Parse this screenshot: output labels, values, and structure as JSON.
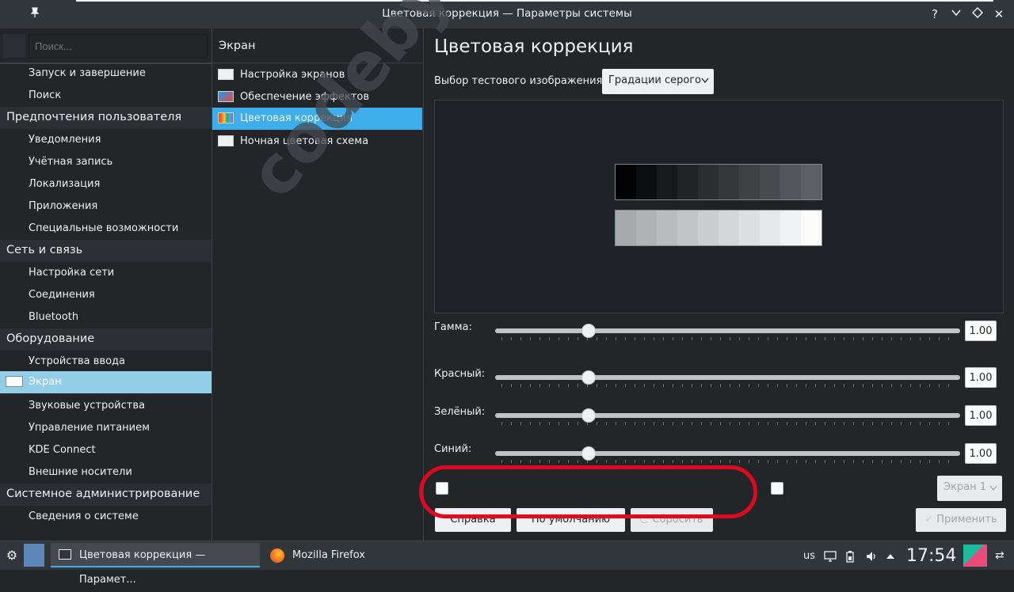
{
  "window": {
    "title": "Цветовая коррекция — Параметры системы",
    "pin_icon": "pin-icon",
    "help_icon": "?",
    "minimize_icon": "chevron-down-icon",
    "maximize_icon": "diamond-icon",
    "close_icon": "✕"
  },
  "sidebar": {
    "search_placeholder": "Поиск...",
    "categories": [
      {
        "label": "Предпочтения пользователя"
      },
      {
        "label": "Сеть и связь"
      },
      {
        "label": "Оборудование"
      },
      {
        "label": "Системное администрирование"
      }
    ],
    "items": [
      {
        "label": "Запуск и завершение"
      },
      {
        "label": "Поиск"
      },
      {
        "label": "Уведомления"
      },
      {
        "label": "Учётная запись"
      },
      {
        "label": "Локализация"
      },
      {
        "label": "Приложения"
      },
      {
        "label": "Специальные возможности"
      },
      {
        "label": "Настройка сети"
      },
      {
        "label": "Соединения"
      },
      {
        "label": "Bluetooth"
      },
      {
        "label": "Устройства ввода"
      },
      {
        "label": "Экран"
      },
      {
        "label": "Звуковые устройства"
      },
      {
        "label": "Управление питанием"
      },
      {
        "label": "KDE Connect"
      },
      {
        "label": "Внешние носители"
      },
      {
        "label": "Сведения о системе"
      }
    ]
  },
  "midpane": {
    "header": "Экран",
    "items": [
      {
        "label": "Настройка экранов"
      },
      {
        "label": "Обеспечение эффектов"
      },
      {
        "label": "Цветовая коррекция"
      },
      {
        "label": "Ночная цветовая схема"
      }
    ]
  },
  "main": {
    "title": "Цветовая коррекция",
    "test_image_label": "Выбор тестового изображения:",
    "test_image_value": "Градации серого",
    "sliders": [
      {
        "label": "Гамма:",
        "value": "1.00",
        "level": 0.2
      },
      {
        "label": "Красный:",
        "value": "1.00",
        "level": 0.2
      },
      {
        "label": "Зелёный:",
        "value": "1.00",
        "level": 0.2
      },
      {
        "label": "Синий:",
        "value": "1.00",
        "level": 0.2
      }
    ],
    "screen_select": "Экран 1",
    "buttons": {
      "help": "Справка",
      "defaults": "По умолчанию",
      "reset": "Сбросить",
      "apply": "Применить"
    },
    "watermark": "codeby.net"
  },
  "taskbar": {
    "tasks": [
      {
        "label": "Цветовая коррекция — Парамет..."
      },
      {
        "label": "Mozilla Firefox"
      }
    ],
    "keyboard_layout": "us",
    "clock": "17:54"
  },
  "colors": {
    "accent": "#3daee9",
    "background": "#232629",
    "annotation": "#e0081f"
  }
}
